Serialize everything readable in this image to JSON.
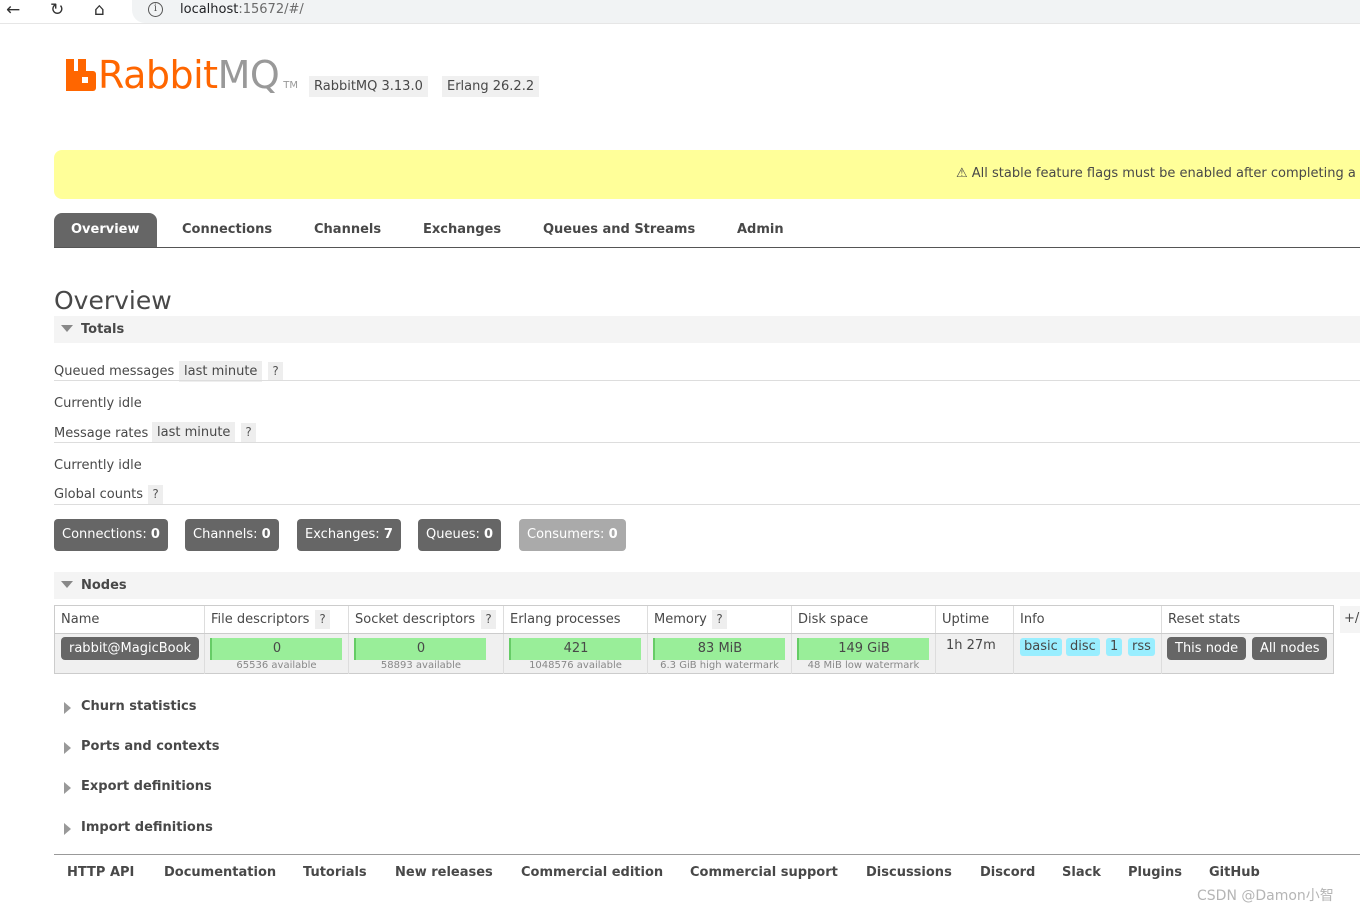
{
  "browser": {
    "url_host": "localhost",
    "url_rest": ":15672/#/"
  },
  "header": {
    "logo_rabbit": "Rabbit",
    "logo_mq": "MQ",
    "logo_tm": "TM",
    "version": "RabbitMQ 3.13.0",
    "erlang": "Erlang 26.2.2"
  },
  "warning": {
    "text": "⚠ All stable feature flags must be enabled after completing a"
  },
  "tabs": [
    "Overview",
    "Connections",
    "Channels",
    "Exchanges",
    "Queues and Streams",
    "Admin"
  ],
  "page_title": "Overview",
  "totals": {
    "header": "Totals",
    "queued_label": "Queued messages",
    "queued_range": "last minute",
    "queued_status": "Currently idle",
    "rates_label": "Message rates",
    "rates_range": "last minute",
    "rates_status": "Currently idle",
    "global_label": "Global counts",
    "help": "?"
  },
  "counts": [
    {
      "label": "Connections:",
      "value": "0"
    },
    {
      "label": "Channels:",
      "value": "0"
    },
    {
      "label": "Exchanges:",
      "value": "7"
    },
    {
      "label": "Queues:",
      "value": "0"
    },
    {
      "label": "Consumers:",
      "value": "0"
    }
  ],
  "nodes": {
    "header": "Nodes",
    "columns": [
      "Name",
      "File descriptors",
      "Socket descriptors",
      "Erlang processes",
      "Memory",
      "Disk space",
      "Uptime",
      "Info",
      "Reset stats"
    ],
    "plusminus": "+/",
    "row": {
      "name": "rabbit@MagicBook",
      "fd_value": "0",
      "fd_sub": "65536 available",
      "sd_value": "0",
      "sd_sub": "58893 available",
      "ep_value": "421",
      "ep_sub": "1048576 available",
      "mem_value": "83 MiB",
      "mem_sub": "6.3 GiB high watermark",
      "disk_value": "149 GiB",
      "disk_sub": "48 MiB low watermark",
      "uptime": "1h 27m",
      "info": [
        "basic",
        "disc",
        "1",
        "rss"
      ],
      "reset_this": "This node",
      "reset_all": "All nodes"
    }
  },
  "collapsed_sections": [
    "Churn statistics",
    "Ports and contexts",
    "Export definitions",
    "Import definitions"
  ],
  "footer_links": [
    "HTTP API",
    "Documentation",
    "Tutorials",
    "New releases",
    "Commercial edition",
    "Commercial support",
    "Discussions",
    "Discord",
    "Slack",
    "Plugins",
    "GitHub"
  ],
  "watermark": "CSDN @Damon小智"
}
